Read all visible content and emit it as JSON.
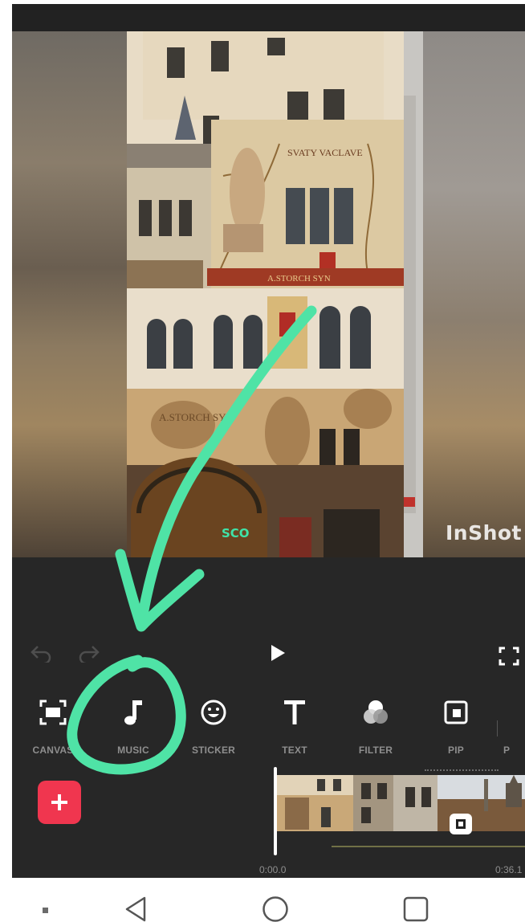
{
  "app": {
    "name": "InShot",
    "watermark": "InShot"
  },
  "tools": [
    {
      "id": "canvas",
      "label": "CANVAS",
      "icon": "canvas-icon"
    },
    {
      "id": "music",
      "label": "MUSIC",
      "icon": "music-note-icon"
    },
    {
      "id": "sticker",
      "label": "STICKER",
      "icon": "sticker-smiley-icon"
    },
    {
      "id": "text",
      "label": "TEXT",
      "icon": "text-t-icon"
    },
    {
      "id": "filter",
      "label": "FILTER",
      "icon": "filter-circles-icon"
    },
    {
      "id": "pip",
      "label": "PIP",
      "icon": "pip-icon"
    },
    {
      "id": "more",
      "label": "P",
      "icon": ""
    }
  ],
  "timeline": {
    "start_time": "0:00.0",
    "end_time": "0:36.1"
  },
  "preview": {
    "building_signs": [
      "SVATY VACLAVE",
      "A.STORCH SYN",
      "SCO"
    ]
  },
  "colors": {
    "accent_add": "#f0364f",
    "annotation": "#4fe3a6",
    "background": "#272727"
  },
  "nav": {
    "icons": [
      "recent-dot-icon",
      "back-triangle-icon",
      "home-circle-icon",
      "overview-square-icon"
    ]
  }
}
